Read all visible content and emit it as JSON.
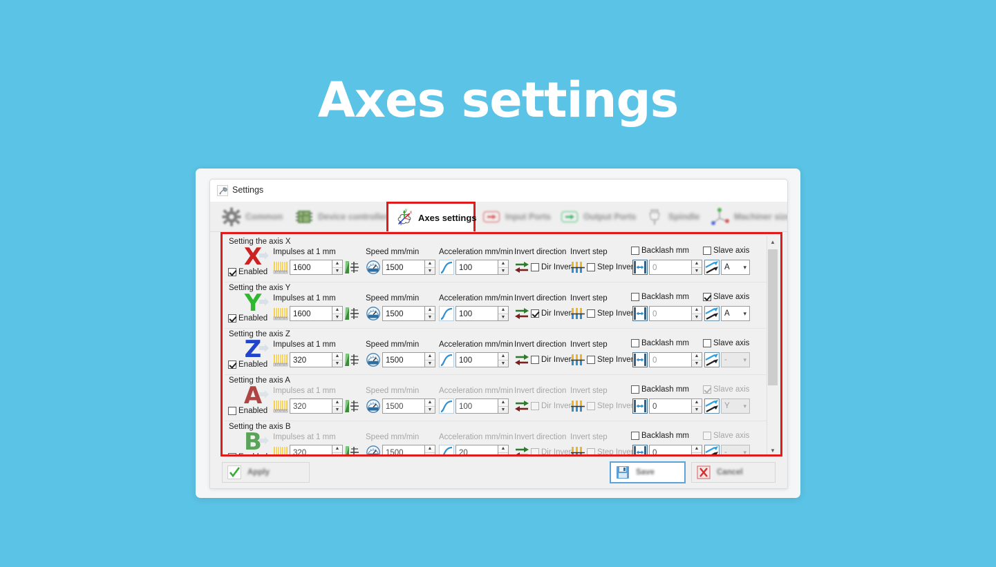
{
  "page": {
    "heading": "Axes settings",
    "background_color": "#5bc3e5"
  },
  "window": {
    "title": "Settings",
    "icon": "wrench-icon",
    "controls": {
      "minimize": "–",
      "maximize": "❐",
      "close": "✕"
    }
  },
  "tabs": [
    {
      "label": "Common",
      "icon": "gear-icon",
      "active": false
    },
    {
      "label": "Device controller",
      "icon": "chip-icon",
      "active": false
    },
    {
      "label": "Axes settings",
      "icon": "axes-icon",
      "active": true
    },
    {
      "label": "Input Ports",
      "icon": "input-arrow-icon",
      "active": false
    },
    {
      "label": "Output Ports",
      "icon": "output-arrow-icon",
      "active": false
    },
    {
      "label": "Spindle",
      "icon": "spindle-icon",
      "active": false
    },
    {
      "label": "Machiner size",
      "icon": "machine-size-icon",
      "active": false
    }
  ],
  "labels": {
    "impulses": "Impulses at 1 mm",
    "speed": "Speed mm/min",
    "acceleration": "Acceleration mm/min",
    "invert_direction": "Invert direction",
    "invert_step": "Invert step",
    "backlash": "Backlash mm",
    "slave_axis": "Slave axis",
    "enabled": "Enabled",
    "dir_invert": "Dir Invert",
    "step_invert": "Step Invert"
  },
  "axes": [
    {
      "group_title": "Setting the axis X",
      "letter": "X",
      "letter_color": "#cc2222",
      "enabled": true,
      "disabled_row": false,
      "impulses": "1600",
      "speed": "1500",
      "acceleration": "100",
      "dir_invert": false,
      "step_invert": false,
      "backlash_enabled": false,
      "backlash": "0",
      "slave_enabled": false,
      "slave_value": "A"
    },
    {
      "group_title": "Setting the axis Y",
      "letter": "Y",
      "letter_color": "#2fb82f",
      "enabled": true,
      "disabled_row": false,
      "impulses": "1600",
      "speed": "1500",
      "acceleration": "100",
      "dir_invert": true,
      "step_invert": false,
      "backlash_enabled": false,
      "backlash": "0",
      "slave_enabled": true,
      "slave_value": "A"
    },
    {
      "group_title": "Setting the axis Z",
      "letter": "Z",
      "letter_color": "#2244cc",
      "enabled": true,
      "disabled_row": false,
      "impulses": "320",
      "speed": "1500",
      "acceleration": "100",
      "dir_invert": false,
      "step_invert": false,
      "backlash_enabled": false,
      "backlash": "0",
      "slave_enabled": false,
      "slave_value": "-"
    },
    {
      "group_title": "Setting the axis A",
      "letter": "A",
      "letter_color": "#9e1515",
      "enabled": false,
      "disabled_row": true,
      "impulses": "320",
      "speed": "1500",
      "acceleration": "100",
      "dir_invert": false,
      "step_invert": false,
      "backlash_enabled": false,
      "backlash": "0",
      "slave_enabled": true,
      "slave_value": "Y"
    },
    {
      "group_title": "Setting the axis B",
      "letter": "B",
      "letter_color": "#2f8f2f",
      "enabled": false,
      "disabled_row": true,
      "impulses": "320",
      "speed": "1500",
      "acceleration": "20",
      "dir_invert": false,
      "step_invert": false,
      "backlash_enabled": false,
      "backlash": "0",
      "slave_enabled": false,
      "slave_value": "-"
    }
  ],
  "footer": {
    "apply": "Apply",
    "save": "Save",
    "cancel": "Cancel"
  }
}
